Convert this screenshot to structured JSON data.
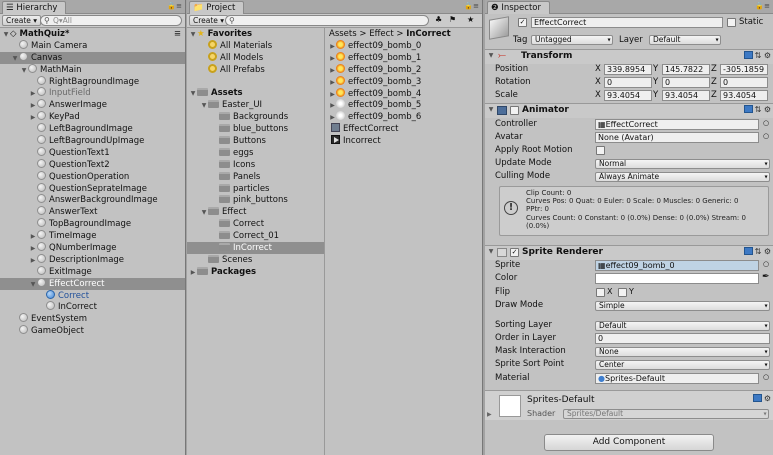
{
  "hierarchy": {
    "tab": "Hierarchy",
    "create": "Create",
    "search_placeholder": "Q▾All",
    "scene": "MathQuiz*",
    "items": [
      {
        "label": "Main Camera",
        "indent": 1,
        "tri": "",
        "grey": false,
        "sel": false
      },
      {
        "label": "Canvas",
        "indent": 1,
        "tri": "▼",
        "grey": false,
        "sel": true
      },
      {
        "label": "MathMain",
        "indent": 2,
        "tri": "▼",
        "grey": false,
        "sel": false
      },
      {
        "label": "RightBagroundImage",
        "indent": 3,
        "tri": "",
        "grey": false,
        "sel": false
      },
      {
        "label": "InputField",
        "indent": 3,
        "tri": "▶",
        "grey": true,
        "sel": false
      },
      {
        "label": "AnswerImage",
        "indent": 3,
        "tri": "▶",
        "grey": false,
        "sel": false
      },
      {
        "label": "KeyPad",
        "indent": 3,
        "tri": "▶",
        "grey": false,
        "sel": false
      },
      {
        "label": "LeftBagroundImage",
        "indent": 3,
        "tri": "",
        "grey": false,
        "sel": false
      },
      {
        "label": "LeftBagroundUpImage",
        "indent": 3,
        "tri": "",
        "grey": false,
        "sel": false
      },
      {
        "label": "QuestionText1",
        "indent": 3,
        "tri": "",
        "grey": false,
        "sel": false
      },
      {
        "label": "QuestionText2",
        "indent": 3,
        "tri": "",
        "grey": false,
        "sel": false
      },
      {
        "label": "QuestionOperation",
        "indent": 3,
        "tri": "",
        "grey": false,
        "sel": false
      },
      {
        "label": "QuestionSeprateImage",
        "indent": 3,
        "tri": "",
        "grey": false,
        "sel": false
      },
      {
        "label": "AnswerBackgroundImage",
        "indent": 3,
        "tri": "",
        "grey": false,
        "sel": false
      },
      {
        "label": "AnswerText",
        "indent": 3,
        "tri": "",
        "grey": false,
        "sel": false
      },
      {
        "label": "TopBagroundImage",
        "indent": 3,
        "tri": "",
        "grey": false,
        "sel": false
      },
      {
        "label": "TimeImage",
        "indent": 3,
        "tri": "▶",
        "grey": false,
        "sel": false
      },
      {
        "label": "QNumberImage",
        "indent": 3,
        "tri": "▶",
        "grey": false,
        "sel": false
      },
      {
        "label": "DescriptionImage",
        "indent": 3,
        "tri": "▶",
        "grey": false,
        "sel": false
      },
      {
        "label": "ExitImage",
        "indent": 3,
        "tri": "",
        "grey": false,
        "sel": false
      },
      {
        "label": "EffectCorrect",
        "indent": 3,
        "tri": "▼",
        "grey": false,
        "sel": true,
        "white": true
      },
      {
        "label": "Correct",
        "indent": 4,
        "tri": "",
        "grey": false,
        "sel": false,
        "blue": true
      },
      {
        "label": "InCorrect",
        "indent": 4,
        "tri": "",
        "grey": false,
        "sel": false
      },
      {
        "label": "EventSystem",
        "indent": 1,
        "tri": "",
        "grey": false,
        "sel": false
      },
      {
        "label": "GameObject",
        "indent": 1,
        "tri": "",
        "grey": false,
        "sel": false
      }
    ]
  },
  "project": {
    "tab": "Project",
    "create": "Create",
    "tree": [
      {
        "label": "Favorites",
        "indent": 0,
        "tri": "▼",
        "bold": true,
        "icon": "star"
      },
      {
        "label": "All Materials",
        "indent": 1,
        "tri": "",
        "icon": "fav"
      },
      {
        "label": "All Models",
        "indent": 1,
        "tri": "",
        "icon": "fav"
      },
      {
        "label": "All Prefabs",
        "indent": 1,
        "tri": "",
        "icon": "fav"
      },
      {
        "label": "",
        "indent": 0,
        "tri": "",
        "icon": "none"
      },
      {
        "label": "Assets",
        "indent": 0,
        "tri": "▼",
        "bold": true,
        "icon": "folder"
      },
      {
        "label": "Easter_UI",
        "indent": 1,
        "tri": "▼",
        "icon": "folder"
      },
      {
        "label": "Backgrounds",
        "indent": 2,
        "tri": "",
        "icon": "folder"
      },
      {
        "label": "blue_buttons",
        "indent": 2,
        "tri": "",
        "icon": "folder"
      },
      {
        "label": "Buttons",
        "indent": 2,
        "tri": "",
        "icon": "folder"
      },
      {
        "label": "eggs",
        "indent": 2,
        "tri": "",
        "icon": "folder"
      },
      {
        "label": "Icons",
        "indent": 2,
        "tri": "",
        "icon": "folder"
      },
      {
        "label": "Panels",
        "indent": 2,
        "tri": "",
        "icon": "folder"
      },
      {
        "label": "particles",
        "indent": 2,
        "tri": "",
        "icon": "folder"
      },
      {
        "label": "pink_buttons",
        "indent": 2,
        "tri": "",
        "icon": "folder"
      },
      {
        "label": "Effect",
        "indent": 1,
        "tri": "▼",
        "icon": "folder"
      },
      {
        "label": "Correct",
        "indent": 2,
        "tri": "",
        "icon": "folder"
      },
      {
        "label": "Correct_01",
        "indent": 2,
        "tri": "",
        "icon": "folder"
      },
      {
        "label": "InCorrect",
        "indent": 2,
        "tri": "",
        "icon": "folder",
        "sel": true
      },
      {
        "label": "Scenes",
        "indent": 1,
        "tri": "",
        "icon": "folder"
      },
      {
        "label": "Packages",
        "indent": 0,
        "tri": "▶",
        "bold": true,
        "icon": "folder"
      }
    ],
    "breadcrumb": [
      "Assets",
      "Effect",
      "InCorrect"
    ],
    "files": [
      {
        "label": "effect09_bomb_0",
        "icon": "burst",
        "tri": "▶"
      },
      {
        "label": "effect09_bomb_1",
        "icon": "burst",
        "tri": "▶"
      },
      {
        "label": "effect09_bomb_2",
        "icon": "burst",
        "tri": "▶"
      },
      {
        "label": "effect09_bomb_3",
        "icon": "burst",
        "tri": "▶"
      },
      {
        "label": "effect09_bomb_4",
        "icon": "burst",
        "tri": "▶"
      },
      {
        "label": "effect09_bomb_5",
        "icon": "dim",
        "tri": "▶"
      },
      {
        "label": "effect09_bomb_6",
        "icon": "dim",
        "tri": "▶"
      },
      {
        "label": "EffectCorrect",
        "icon": "anim",
        "tri": ""
      },
      {
        "label": "Incorrect",
        "icon": "anim2",
        "tri": ""
      }
    ]
  },
  "inspector": {
    "tab": "Inspector",
    "object_name": "EffectCorrect",
    "static_label": "Static",
    "tag_label": "Tag",
    "tag_value": "Untagged",
    "layer_label": "Layer",
    "layer_value": "Default",
    "transform": {
      "title": "Transform",
      "position_label": "Position",
      "rotation_label": "Rotation",
      "scale_label": "Scale",
      "position": [
        "339.8954",
        "145.7822",
        "-305.1859"
      ],
      "rotation": [
        "0",
        "0",
        "0"
      ],
      "scale": [
        "93.4054",
        "93.4054",
        "93.4054"
      ]
    },
    "animator": {
      "title": "Animator",
      "controller_label": "Controller",
      "controller_value": "EffectCorrect",
      "avatar_label": "Avatar",
      "avatar_value": "None (Avatar)",
      "root_motion_label": "Apply Root Motion",
      "update_mode_label": "Update Mode",
      "update_mode_value": "Normal",
      "culling_mode_label": "Culling Mode",
      "culling_mode_value": "Always Animate",
      "info_lines": [
        "Clip Count: 0",
        "Curves Pos: 0 Quat: 0 Euler: 0 Scale: 0 Muscles: 0 Generic: 0",
        "PPtr: 0",
        "Curves Count: 0 Constant: 0 (0.0%) Dense: 0 (0.0%) Stream: 0",
        "(0.0%)"
      ]
    },
    "sprite_renderer": {
      "title": "Sprite Renderer",
      "sprite_label": "Sprite",
      "sprite_value": "effect09_bomb_0",
      "color_label": "Color",
      "flip_label": "Flip",
      "flip_x": "X",
      "flip_y": "Y",
      "draw_mode_label": "Draw Mode",
      "draw_mode_value": "Simple",
      "sorting_layer_label": "Sorting Layer",
      "sorting_layer_value": "Default",
      "order_label": "Order in Layer",
      "order_value": "0",
      "mask_label": "Mask Interaction",
      "mask_value": "None",
      "sort_point_label": "Sprite Sort Point",
      "sort_point_value": "Center",
      "material_label": "Material",
      "material_value": "Sprites-Default"
    },
    "material": {
      "name": "Sprites-Default",
      "shader_label": "Shader",
      "shader_value": "Sprites/Default"
    },
    "add_component": "Add Component"
  }
}
